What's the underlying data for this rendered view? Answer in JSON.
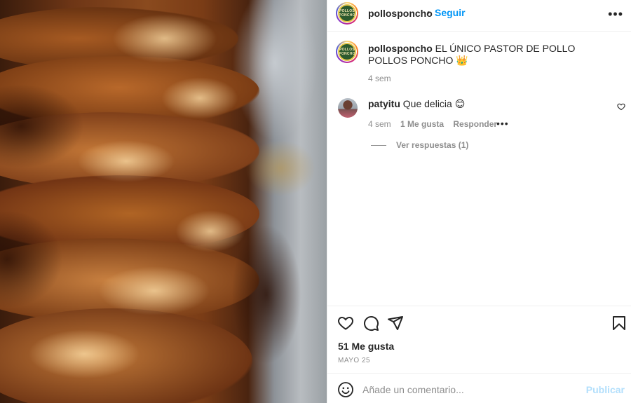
{
  "post": {
    "image_alt": "pastor de pollo",
    "logo_lines": [
      "POLLOS",
      "PONCHO"
    ]
  },
  "header": {
    "username": "pollosponcho",
    "separator": "•",
    "follow_label": "Seguir",
    "more_icon": "more-options-icon",
    "more_glyph": "•••"
  },
  "caption": {
    "username": "pollosponcho",
    "text": "EL ÚNICO PASTOR DE POLLO POLLOS PONCHO 👑",
    "time": "4 sem"
  },
  "comment": {
    "username": "patyitu",
    "text": "Que delicia 😊",
    "time": "4 sem",
    "likes": "1 Me gusta",
    "reply_label": "Responder",
    "more_glyph": "•••",
    "view_replies": "Ver respuestas (1)"
  },
  "actions": {
    "likes_count": "51 Me gusta",
    "date": "MAYO 25"
  },
  "comment_box": {
    "placeholder": "Añade un comentario...",
    "publish_label": "Publicar"
  },
  "colors": {
    "accent": "#0095f6",
    "publish_disabled": "#b2dffc",
    "text": "#262626",
    "muted": "#8e8e8e",
    "border": "#efefef"
  }
}
